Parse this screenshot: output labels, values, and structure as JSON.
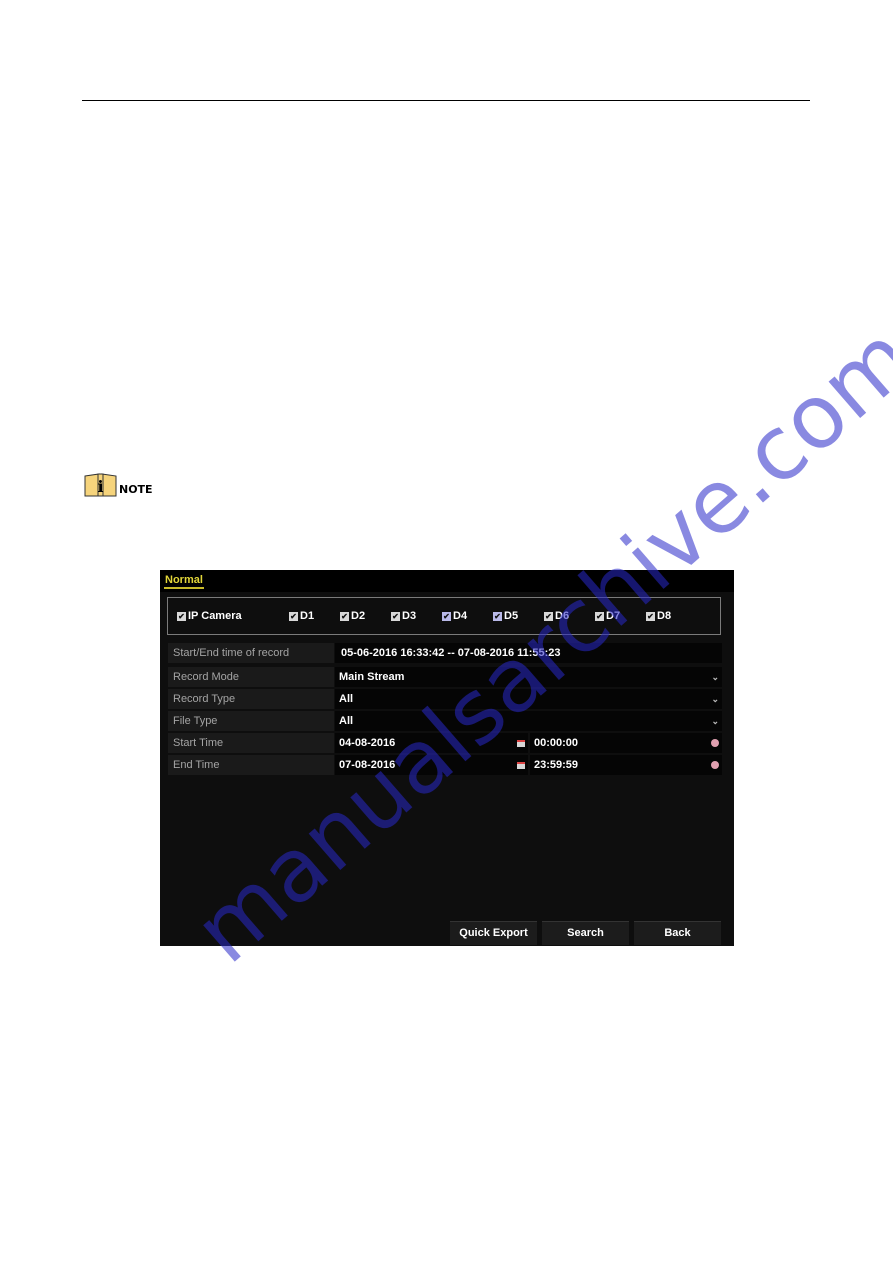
{
  "note": {
    "label": "NOTE",
    "icon": "info-book-icon"
  },
  "dvr": {
    "tab": "Normal",
    "channels": [
      {
        "label": "IP Camera",
        "checked": true
      },
      {
        "label": "D1",
        "checked": true
      },
      {
        "label": "D2",
        "checked": true
      },
      {
        "label": "D3",
        "checked": true
      },
      {
        "label": "D4",
        "checked": true
      },
      {
        "label": "D5",
        "checked": true
      },
      {
        "label": "D6",
        "checked": true
      },
      {
        "label": "D7",
        "checked": true
      },
      {
        "label": "D8",
        "checked": true
      }
    ],
    "record_range": {
      "label": "Start/End time of record",
      "value": "05-06-2016 16:33:42 -- 07-08-2016 11:55:23"
    },
    "record_mode": {
      "label": "Record Mode",
      "value": "Main Stream"
    },
    "record_type": {
      "label": "Record Type",
      "value": "All"
    },
    "file_type": {
      "label": "File Type",
      "value": "All"
    },
    "start_time": {
      "label": "Start Time",
      "date": "04-08-2016",
      "time": "00:00:00"
    },
    "end_time": {
      "label": "End Time",
      "date": "07-08-2016",
      "time": "23:59:59"
    },
    "buttons": {
      "quick_export": "Quick Export",
      "search": "Search",
      "back": "Back"
    }
  },
  "watermark": "manualsarchive.com"
}
